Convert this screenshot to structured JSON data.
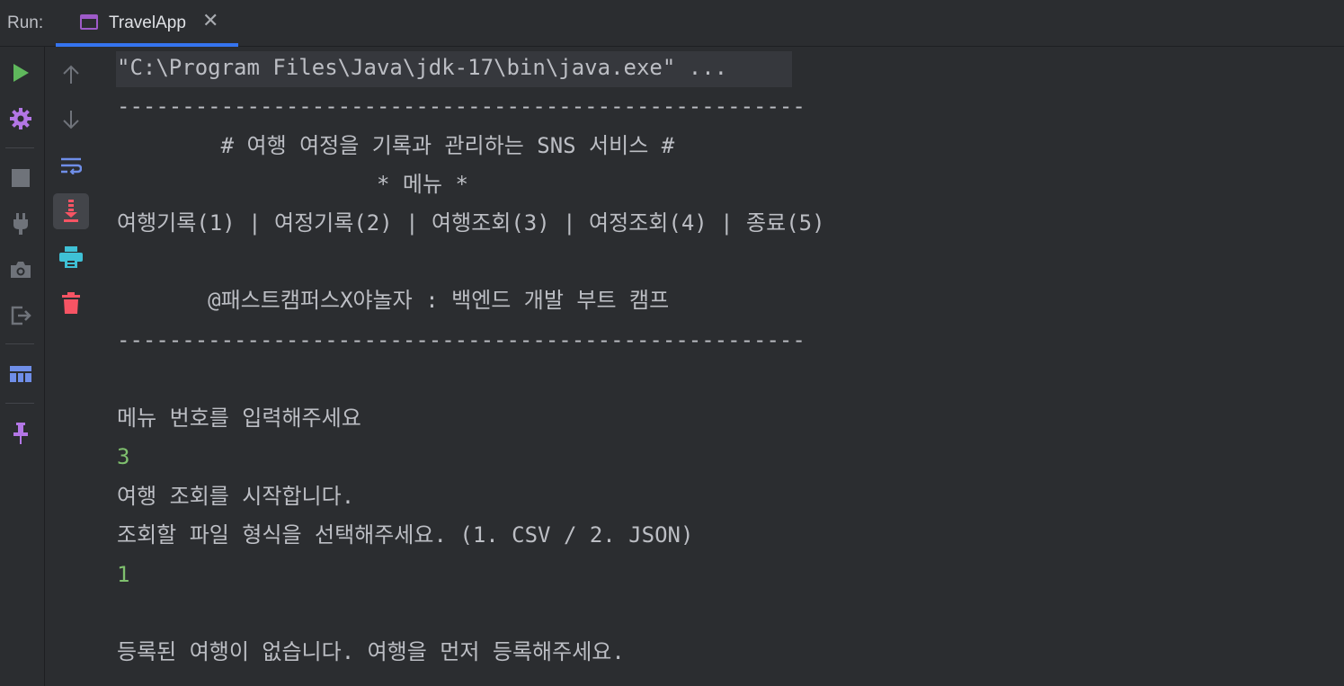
{
  "run_label": "Run:",
  "tab": {
    "title": "TravelApp",
    "close": "✕"
  },
  "colors": {
    "accent": "#3574f0",
    "run_green": "#5fb85c",
    "input_green": "#7fc06e",
    "trash_red": "#f75464",
    "print_cyan": "#3fc1d6",
    "wrap_blue": "#6f8ee8"
  },
  "toolbar_primary": [
    {
      "name": "rerun",
      "icon": "play-icon"
    },
    {
      "name": "settings",
      "icon": "gear-icon"
    },
    {
      "name": "stop",
      "icon": "stop-icon"
    },
    {
      "name": "attach",
      "icon": "plug-icon"
    },
    {
      "name": "screenshot",
      "icon": "camera-icon"
    },
    {
      "name": "exit",
      "icon": "exit-icon"
    },
    {
      "name": "layout",
      "icon": "layout-icon"
    },
    {
      "name": "pin",
      "icon": "pin-icon"
    }
  ],
  "toolbar_secondary": [
    {
      "name": "up",
      "icon": "arrow-up-icon"
    },
    {
      "name": "down",
      "icon": "arrow-down-icon"
    },
    {
      "name": "soft-wrap",
      "icon": "soft-wrap-icon"
    },
    {
      "name": "scroll-to-end",
      "icon": "scroll-to-end-icon"
    },
    {
      "name": "print",
      "icon": "print-icon"
    },
    {
      "name": "clear",
      "icon": "trash-icon"
    }
  ],
  "console": {
    "command": "\"C:\\Program Files\\Java\\jdk-17\\bin\\java.exe\" ...",
    "divider1": "-----------------------------------------------------",
    "title": "        # 여행 여정을 기록과 관리하는 SNS 서비스 #",
    "menu_header": "                    * 메뉴 *",
    "menu_items": "여행기록(1) | 여정기록(2) | 여행조회(3) | 여정조회(4) | 종료(5)",
    "credit": "       @패스트캠퍼스X야놀자 : 백엔드 개발 부트 캠프",
    "divider2": "-----------------------------------------------------",
    "prompt_menu": "메뉴 번호를 입력해주세요",
    "input_menu": "3",
    "msg_start": "여행 조회를 시작합니다.",
    "prompt_format": "조회할 파일 형식을 선택해주세요. (1. CSV / 2. JSON)",
    "input_format": "1",
    "msg_empty": "등록된 여행이 없습니다. 여행을 먼저 등록해주세요."
  }
}
